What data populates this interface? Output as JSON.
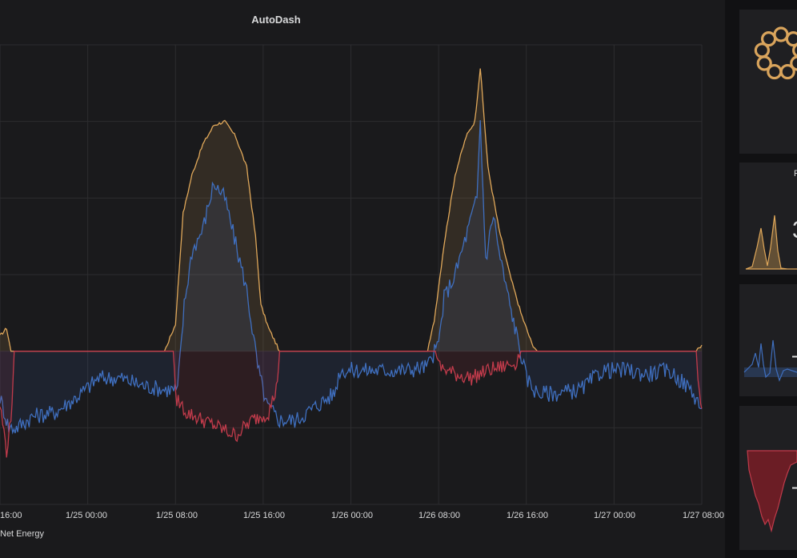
{
  "dashboard": {
    "title": "AutoDash"
  },
  "side_panels": [
    {
      "title_fragment": "P",
      "value_fragment": "3",
      "color": "#e0a85a"
    },
    {
      "value_fragment": "–",
      "color": "#3f6fbf"
    },
    {
      "value_fragment": "–",
      "color": "#c13b4b"
    }
  ],
  "colors": {
    "solar": "#e0a85a",
    "consumption": "#3f6fbf",
    "net": "#c13b4b"
  },
  "chart_data": {
    "type": "line",
    "title": "AutoDash",
    "xlabel": "",
    "ylabel": "",
    "x_tick_labels": [
      "16:00",
      "1/25 00:00",
      "1/25 08:00",
      "1/25 16:00",
      "1/26 00:00",
      "1/26 08:00",
      "1/26 16:00",
      "1/27 00:00",
      "1/27 08:00"
    ],
    "y_tick_labels": [],
    "grid": true,
    "x_unit": "hours since 1/24 16:00",
    "xlim": [
      0,
      64
    ],
    "ylim": [
      -2,
      4
    ],
    "legend_visible": [
      "Net Energy"
    ],
    "series": [
      {
        "name": "",
        "color": "#e0a85a",
        "fill": true,
        "points": [
          [
            0,
            0.2
          ],
          [
            0.6,
            0.3
          ],
          [
            1,
            0
          ],
          [
            15,
            0
          ],
          [
            16,
            0.35
          ],
          [
            16.7,
            1.8
          ],
          [
            17.5,
            2.3
          ],
          [
            18.5,
            2.7
          ],
          [
            19.5,
            2.95
          ],
          [
            20.5,
            3.0
          ],
          [
            21.5,
            2.8
          ],
          [
            22.5,
            2.4
          ],
          [
            23.3,
            1.5
          ],
          [
            23.8,
            0.6
          ],
          [
            24.5,
            0.3
          ],
          [
            25.5,
            0
          ],
          [
            39,
            0
          ],
          [
            39.6,
            0.4
          ],
          [
            40.5,
            1.4
          ],
          [
            41.5,
            2.3
          ],
          [
            42.5,
            2.8
          ],
          [
            43.3,
            3.0
          ],
          [
            43.8,
            3.7
          ],
          [
            44.5,
            2.4
          ],
          [
            45.5,
            1.6
          ],
          [
            46.5,
            1.0
          ],
          [
            47.5,
            0.5
          ],
          [
            48.5,
            0.1
          ],
          [
            49,
            0
          ],
          [
            63.5,
            0
          ],
          [
            64,
            0.08
          ]
        ]
      },
      {
        "name": "",
        "color": "#3f6fbf",
        "fill": true,
        "points": [
          [
            0,
            -0.6
          ],
          [
            0.8,
            -1.0
          ],
          [
            1.5,
            -1.0
          ],
          [
            3,
            -0.85
          ],
          [
            5,
            -0.8
          ],
          [
            7,
            -0.6
          ],
          [
            9,
            -0.35
          ],
          [
            11,
            -0.35
          ],
          [
            13,
            -0.45
          ],
          [
            15,
            -0.5
          ],
          [
            16.2,
            -0.5
          ],
          [
            16.8,
            0.6
          ],
          [
            17.5,
            1.3
          ],
          [
            18.5,
            1.6
          ],
          [
            19.5,
            2.2
          ],
          [
            20.5,
            2.0
          ],
          [
            21.5,
            1.4
          ],
          [
            22.5,
            0.8
          ],
          [
            23.5,
            -0.2
          ],
          [
            24.3,
            -0.7
          ],
          [
            25.5,
            -0.9
          ],
          [
            27,
            -0.9
          ],
          [
            29,
            -0.7
          ],
          [
            30.5,
            -0.55
          ],
          [
            31,
            -0.25
          ],
          [
            33,
            -0.25
          ],
          [
            35,
            -0.25
          ],
          [
            37,
            -0.25
          ],
          [
            39,
            -0.2
          ],
          [
            40,
            0.1
          ],
          [
            40.5,
            0.7
          ],
          [
            41.5,
            1.0
          ],
          [
            42.5,
            1.5
          ],
          [
            43.5,
            2.0
          ],
          [
            43.8,
            3.0
          ],
          [
            44.3,
            1.2
          ],
          [
            45,
            1.8
          ],
          [
            45.5,
            1.3
          ],
          [
            46.5,
            0.6
          ],
          [
            47.3,
            0.1
          ],
          [
            48,
            -0.35
          ],
          [
            49,
            -0.55
          ],
          [
            51,
            -0.55
          ],
          [
            53,
            -0.5
          ],
          [
            55,
            -0.25
          ],
          [
            57,
            -0.25
          ],
          [
            59,
            -0.3
          ],
          [
            61,
            -0.25
          ],
          [
            63,
            -0.5
          ],
          [
            64,
            -0.75
          ]
        ]
      },
      {
        "name": "Net Energy",
        "color": "#c13b4b",
        "fill": true,
        "points": [
          [
            0,
            -0.7
          ],
          [
            0.6,
            -1.3
          ],
          [
            1,
            -0.9
          ],
          [
            1.3,
            0
          ],
          [
            15.8,
            0
          ],
          [
            16,
            -0.6
          ],
          [
            17,
            -0.8
          ],
          [
            18.5,
            -0.9
          ],
          [
            20,
            -1.0
          ],
          [
            21.5,
            -1.1
          ],
          [
            23,
            -0.9
          ],
          [
            24.5,
            -0.8
          ],
          [
            25.2,
            -0.5
          ],
          [
            25.5,
            0
          ],
          [
            39.7,
            0
          ],
          [
            40,
            -0.2
          ],
          [
            41.5,
            -0.3
          ],
          [
            43,
            -0.35
          ],
          [
            44.5,
            -0.25
          ],
          [
            46,
            -0.2
          ],
          [
            47,
            -0.15
          ],
          [
            47.5,
            0
          ],
          [
            63.5,
            0
          ],
          [
            63.8,
            -0.6
          ],
          [
            64,
            -0.75
          ]
        ]
      }
    ]
  }
}
